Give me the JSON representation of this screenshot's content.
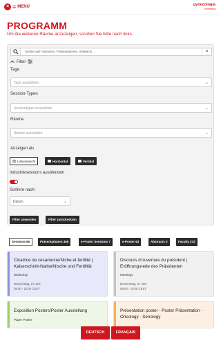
{
  "header": {
    "close_glyph": "×",
    "menu_glyph": "≡",
    "menu_label": "MENÜ",
    "logo_main": "gynecologia",
    "logo_sub": "helvetica"
  },
  "page": {
    "title": "PROGRAMM",
    "subtitle": "Um die weiteren Räume anzuzeigen, scrollen Sie bitte nach links."
  },
  "search": {
    "placeholder": "Suche nach Sessions, Präsentationen, Abstracts ...",
    "clear_glyph": "×"
  },
  "filter": {
    "label": "Filter",
    "tage_label": "Tage",
    "tage_placeholder": "Tage auswählen",
    "session_types_label": "Session-Typen",
    "session_types_placeholder": "Sessiontypen auswählen",
    "rooms_label": "Räume",
    "rooms_placeholder": "Räume auswählen",
    "show_as_label": "Anzeigen als",
    "view_list": "Listenansicht",
    "view_horizontal": "Horizontal",
    "view_vertical": "Vertikal",
    "hide_industry_label": "Industriesessions ausblenden",
    "hide_industry_on": true,
    "sort_label": "Sortiere nach:",
    "sort_value": "Datum",
    "apply_button": "Filter anwenden",
    "reset_button": "Filter zurücksetzen",
    "chevron": "⌄"
  },
  "tabs": [
    {
      "label": "Sessions 66",
      "active": true
    },
    {
      "label": "Präsentationen 366",
      "active": false
    },
    {
      "label": "e-Poster Sessions 7",
      "active": false
    },
    {
      "label": "e-Poster 63",
      "active": false
    },
    {
      "label": "Abstracts 0",
      "active": false
    },
    {
      "label": "Faculty 272",
      "active": false
    }
  ],
  "cards": [
    {
      "title": "Cicatrice de césarienne/Niche et fertilité | Kaiserschnitt-Narbe/Nische und Fertilität",
      "type": "Workshop",
      "date": "Donnerstag, 27 Juni",
      "time": "09:00 - 10:00 CEST",
      "bg": "#e7e9fb",
      "accent": "#8a94e0"
    },
    {
      "title": "Discours d'ouverture du président | Eröffnungsrede des Präsidenten",
      "type": "Meetings",
      "date": "Donnerstag, 27 Juni",
      "time": "09:00 - 10:00 CEST",
      "bg": "#f1f1f1",
      "accent": "#c4c4c4"
    },
    {
      "title": "Exposition Posters/Poster Ausstellung",
      "type": "Paper Poster",
      "bg": "#eef6e6",
      "accent": "#9cd06a"
    },
    {
      "title": "Présentation poster - Poster Präsentation - Oncology - Senology",
      "type": "",
      "bg": "#fdf0e2",
      "accent": "#f3b066"
    }
  ],
  "language": {
    "de": "DEUTSCH",
    "fr": "FRANÇAIS"
  },
  "colors": {
    "brand_red": "#d0161f",
    "dark_button": "#2b2b2b"
  }
}
